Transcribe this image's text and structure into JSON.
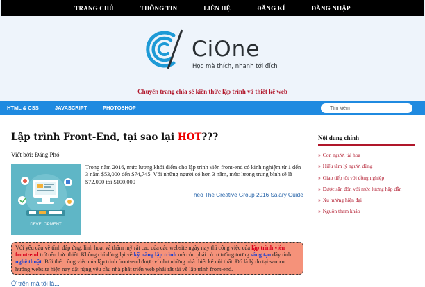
{
  "nav": {
    "items": [
      "TRANG CHỦ",
      "THÔNG TIN",
      "LIÊN HỆ",
      "ĐĂNG KÍ",
      "ĐĂNG NHẬP"
    ]
  },
  "brand": {
    "name": "CiOne",
    "tagline": "Học mà thích, nhanh tới đích",
    "slogan": "Chuyên trang chia sẻ kiến thức lập trình và thiết kế web",
    "logo_color": "#1e9ad6"
  },
  "categories": {
    "items": [
      "HTML & CSS",
      "JAVASCRIPT",
      "PHOTOSHOP"
    ],
    "search_placeholder": "Tìm kiếm"
  },
  "article": {
    "title_prefix": "Lập trình Front-End, tại sao lại ",
    "title_hot": "HOT",
    "title_suffix": "???",
    "author": "Viết bởi: Đăng Phó",
    "intro": "Trong năm 2016, mức lương khởi điểm cho lập trình viên front-end có kinh nghiệm từ 1 đến 3 năm $53,000 đến $74,745. Với những người có hơn 3 năm, mức lương trung bình sẽ là $72,000 tới $100,000",
    "source": "Theo The Creative Group 2016 Salary Guide",
    "thumb_label": "DEVELOPMENT",
    "callout": {
      "t1": "Với yêu cầu về tính đáp ứng, linh hoạt và thẩm mỹ rất cao của các website ngày nay thì công việc của ",
      "h1": "lập trình viên front-end",
      "t2": " trở nên bức thiết. Không chỉ dừng lại về ",
      "h2": "kỹ năng lập trình",
      "t3": " mà còn phải có tư tưởng tương ",
      "h3": "sáng tạo",
      "t4": " đầy tính ",
      "h4": "nghệ thuật",
      "t5": ". Bởi thế, công việc của lập trình front-end được ví như những nhà thiết kế nội thất. Đó là lý do tại sao xu hướng website hiện nay đặt nặng yêu cầu nhà phát triển web phải rất tài về lập trình front-end."
    },
    "trail": "Ở trên mà tôi là..."
  },
  "sidebar": {
    "title": "Nội dung chính",
    "items": [
      "Con người tài hoa",
      "Hiểu tâm lý người dùng",
      "Giao tiếp tốt với đồng nghiệp",
      "Được săn đón với mức lương hấp dẫn",
      "Xu hướng hiện đại",
      "Nguồn tham khảo"
    ]
  }
}
